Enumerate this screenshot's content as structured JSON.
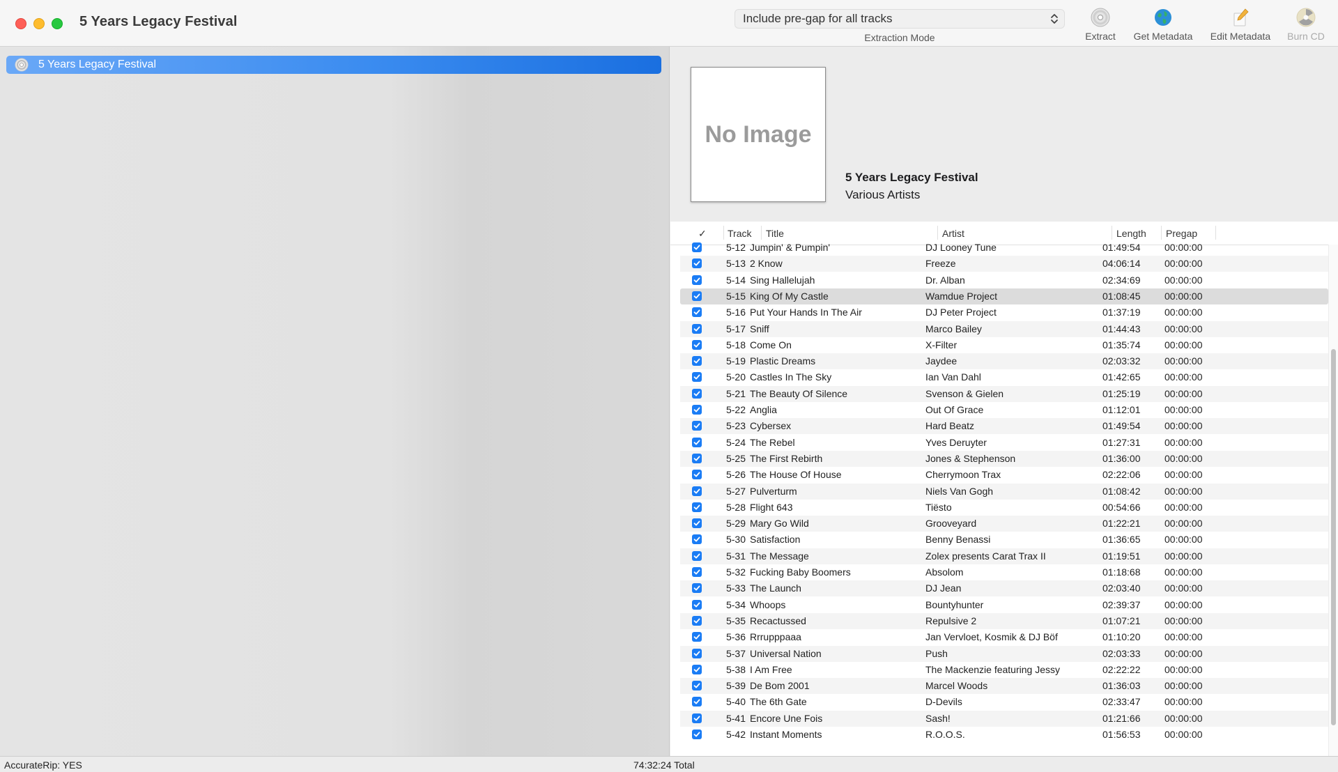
{
  "window": {
    "title": "5 Years Legacy Festival"
  },
  "toolbar": {
    "extraction_mode": {
      "value": "Include pre-gap for all tracks",
      "caption": "Extraction Mode"
    },
    "buttons": [
      {
        "label": "Extract",
        "icon": "extract-disc-icon",
        "enabled": true
      },
      {
        "label": "Get Metadata",
        "icon": "globe-icon",
        "enabled": true
      },
      {
        "label": "Edit Metadata",
        "icon": "pencil-icon",
        "enabled": true
      },
      {
        "label": "Burn CD",
        "icon": "burn-disc-icon",
        "enabled": false
      }
    ]
  },
  "sidebar": {
    "items": [
      {
        "label": "5 Years Legacy Festival",
        "icon": "cd-icon",
        "selected": true
      }
    ]
  },
  "album": {
    "artwork_placeholder": "No Image",
    "title": "5 Years Legacy Festival",
    "artist": "Various Artists"
  },
  "table": {
    "columns": {
      "check": "✓",
      "track": "Track",
      "title": "Title",
      "artist": "Artist",
      "length": "Length",
      "pregap": "Pregap"
    },
    "selected_track": "5-15",
    "rows": [
      {
        "checked": true,
        "track": "5-12",
        "title": "Jumpin' & Pumpin'",
        "artist": "DJ Looney Tune",
        "length": "01:49:54",
        "pregap": "00:00:00"
      },
      {
        "checked": true,
        "track": "5-13",
        "title": "2 Know",
        "artist": "Freeze",
        "length": "04:06:14",
        "pregap": "00:00:00"
      },
      {
        "checked": true,
        "track": "5-14",
        "title": "Sing Hallelujah",
        "artist": "Dr. Alban",
        "length": "02:34:69",
        "pregap": "00:00:00"
      },
      {
        "checked": true,
        "track": "5-15",
        "title": "King Of My Castle",
        "artist": "Wamdue Project",
        "length": "01:08:45",
        "pregap": "00:00:00"
      },
      {
        "checked": true,
        "track": "5-16",
        "title": "Put Your Hands In The Air",
        "artist": "DJ Peter Project",
        "length": "01:37:19",
        "pregap": "00:00:00"
      },
      {
        "checked": true,
        "track": "5-17",
        "title": "Sniff",
        "artist": "Marco Bailey",
        "length": "01:44:43",
        "pregap": "00:00:00"
      },
      {
        "checked": true,
        "track": "5-18",
        "title": "Come On",
        "artist": "X-Filter",
        "length": "01:35:74",
        "pregap": "00:00:00"
      },
      {
        "checked": true,
        "track": "5-19",
        "title": "Plastic Dreams",
        "artist": "Jaydee",
        "length": "02:03:32",
        "pregap": "00:00:00"
      },
      {
        "checked": true,
        "track": "5-20",
        "title": "Castles In The Sky",
        "artist": "Ian Van Dahl",
        "length": "01:42:65",
        "pregap": "00:00:00"
      },
      {
        "checked": true,
        "track": "5-21",
        "title": "The Beauty Of Silence",
        "artist": "Svenson & Gielen",
        "length": "01:25:19",
        "pregap": "00:00:00"
      },
      {
        "checked": true,
        "track": "5-22",
        "title": "Anglia",
        "artist": "Out Of Grace",
        "length": "01:12:01",
        "pregap": "00:00:00"
      },
      {
        "checked": true,
        "track": "5-23",
        "title": "Cybersex",
        "artist": "Hard Beatz",
        "length": "01:49:54",
        "pregap": "00:00:00"
      },
      {
        "checked": true,
        "track": "5-24",
        "title": "The Rebel",
        "artist": "Yves Deruyter",
        "length": "01:27:31",
        "pregap": "00:00:00"
      },
      {
        "checked": true,
        "track": "5-25",
        "title": "The First Rebirth",
        "artist": "Jones & Stephenson",
        "length": "01:36:00",
        "pregap": "00:00:00"
      },
      {
        "checked": true,
        "track": "5-26",
        "title": "The House Of House",
        "artist": "Cherrymoon Trax",
        "length": "02:22:06",
        "pregap": "00:00:00"
      },
      {
        "checked": true,
        "track": "5-27",
        "title": "Pulverturm",
        "artist": "Niels Van Gogh",
        "length": "01:08:42",
        "pregap": "00:00:00"
      },
      {
        "checked": true,
        "track": "5-28",
        "title": "Flight 643",
        "artist": "Tiësto",
        "length": "00:54:66",
        "pregap": "00:00:00"
      },
      {
        "checked": true,
        "track": "5-29",
        "title": "Mary Go Wild",
        "artist": "Grooveyard",
        "length": "01:22:21",
        "pregap": "00:00:00"
      },
      {
        "checked": true,
        "track": "5-30",
        "title": "Satisfaction",
        "artist": "Benny Benassi",
        "length": "01:36:65",
        "pregap": "00:00:00"
      },
      {
        "checked": true,
        "track": "5-31",
        "title": "The Message",
        "artist": "Zolex presents Carat Trax II",
        "length": "01:19:51",
        "pregap": "00:00:00"
      },
      {
        "checked": true,
        "track": "5-32",
        "title": "Fucking Baby Boomers",
        "artist": "Absolom",
        "length": "01:18:68",
        "pregap": "00:00:00"
      },
      {
        "checked": true,
        "track": "5-33",
        "title": "The Launch",
        "artist": "DJ Jean",
        "length": "02:03:40",
        "pregap": "00:00:00"
      },
      {
        "checked": true,
        "track": "5-34",
        "title": "Whoops",
        "artist": "Bountyhunter",
        "length": "02:39:37",
        "pregap": "00:00:00"
      },
      {
        "checked": true,
        "track": "5-35",
        "title": "Recactussed",
        "artist": "Repulsive 2",
        "length": "01:07:21",
        "pregap": "00:00:00"
      },
      {
        "checked": true,
        "track": "5-36",
        "title": "Rrrupppaaa",
        "artist": "Jan Vervloet, Kosmik & DJ Böf",
        "length": "01:10:20",
        "pregap": "00:00:00"
      },
      {
        "checked": true,
        "track": "5-37",
        "title": "Universal Nation",
        "artist": "Push",
        "length": "02:03:33",
        "pregap": "00:00:00"
      },
      {
        "checked": true,
        "track": "5-38",
        "title": "I Am Free",
        "artist": "The Mackenzie featuring Jessy",
        "length": "02:22:22",
        "pregap": "00:00:00"
      },
      {
        "checked": true,
        "track": "5-39",
        "title": "De Bom 2001",
        "artist": "Marcel Woods",
        "length": "01:36:03",
        "pregap": "00:00:00"
      },
      {
        "checked": true,
        "track": "5-40",
        "title": "The 6th Gate",
        "artist": "D-Devils",
        "length": "02:33:47",
        "pregap": "00:00:00"
      },
      {
        "checked": true,
        "track": "5-41",
        "title": "Encore Une Fois",
        "artist": "Sash!",
        "length": "01:21:66",
        "pregap": "00:00:00"
      },
      {
        "checked": true,
        "track": "5-42",
        "title": "Instant Moments",
        "artist": "R.O.O.S.",
        "length": "01:56:53",
        "pregap": "00:00:00"
      }
    ]
  },
  "status": {
    "accuraterip": "AccurateRip:  YES",
    "total": "74:32:24 Total"
  },
  "colors": {
    "selection": "#3b8cf0",
    "checkbox": "#1a7cf5",
    "close": "#fe5f57",
    "minimize": "#febc2e",
    "maximize": "#28c840"
  }
}
